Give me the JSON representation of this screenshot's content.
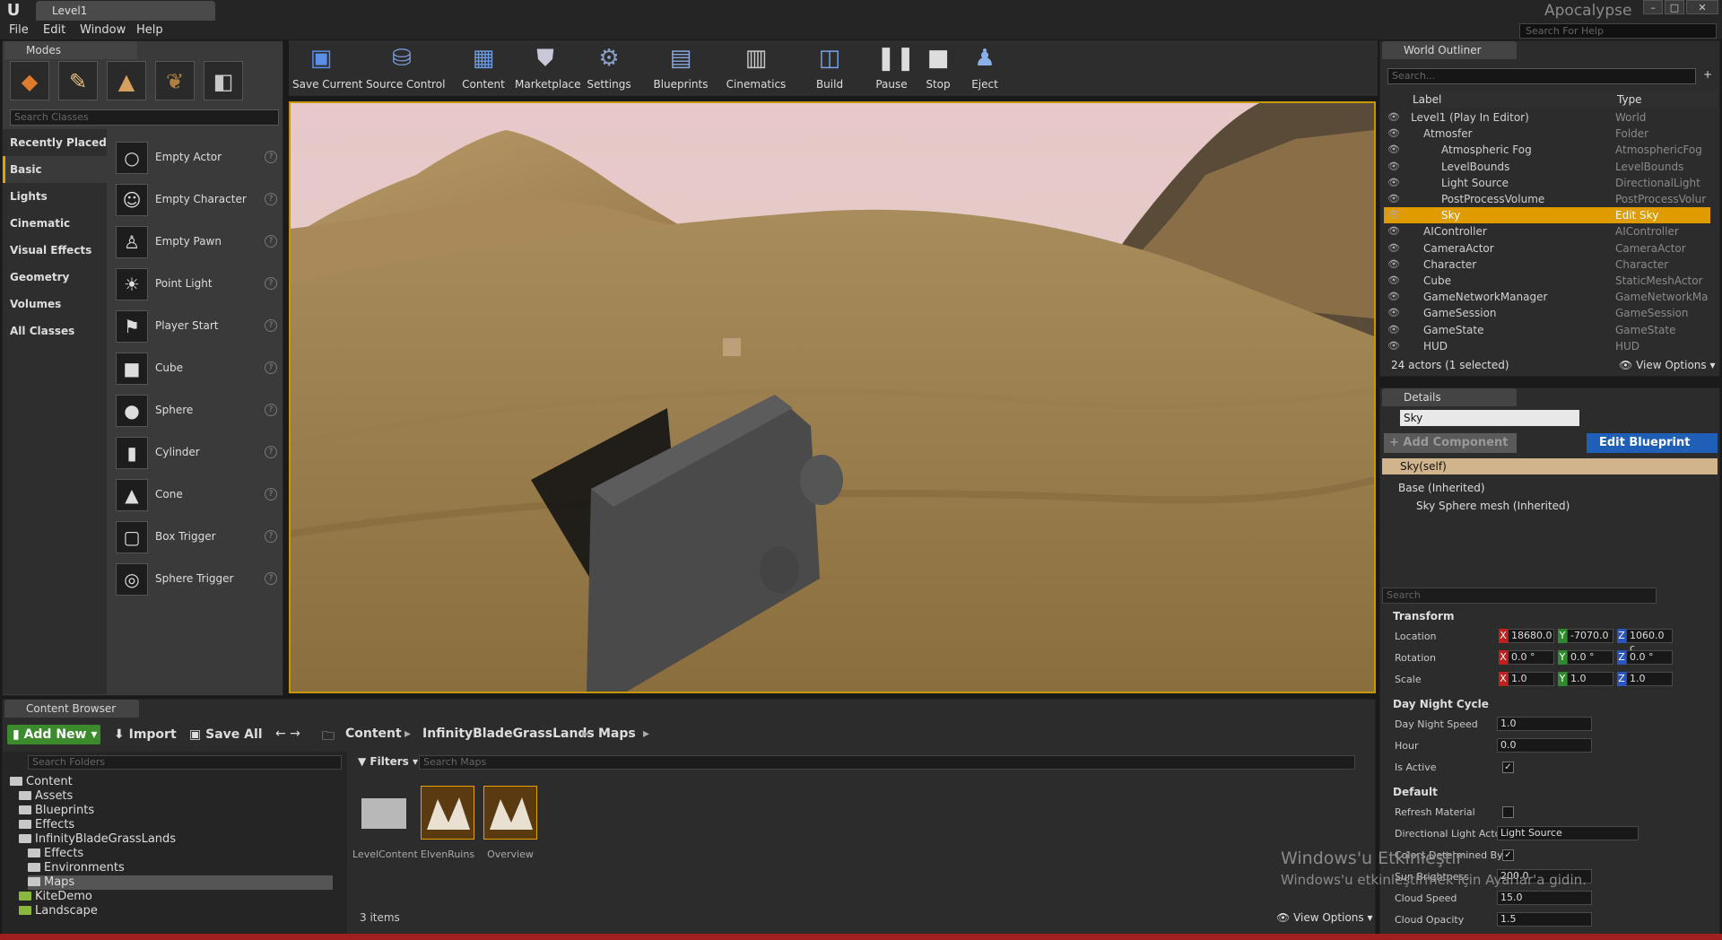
{
  "window": {
    "tab_title": "Level1",
    "project_name": "Apocalypse",
    "help_search_placeholder": "Search For Help"
  },
  "menu": [
    "File",
    "Edit",
    "Window",
    "Help"
  ],
  "modes": {
    "tab_label": "Modes",
    "search_placeholder": "Search Classes",
    "categories": [
      "Recently Placed",
      "Basic",
      "Lights",
      "Cinematic",
      "Visual Effects",
      "Geometry",
      "Volumes",
      "All Classes"
    ],
    "active_category": "Basic",
    "items": [
      "Empty Actor",
      "Empty Character",
      "Empty Pawn",
      "Point Light",
      "Player Start",
      "Cube",
      "Sphere",
      "Cylinder",
      "Cone",
      "Box Trigger",
      "Sphere Trigger"
    ]
  },
  "toolbar": {
    "save_current": "Save Current",
    "source_control": "Source Control",
    "content": "Content",
    "marketplace": "Marketplace",
    "settings": "Settings",
    "blueprints": "Blueprints",
    "cinematics": "Cinematics",
    "build": "Build",
    "pause": "Pause",
    "stop": "Stop",
    "eject": "Eject"
  },
  "outliner": {
    "tab_label": "World Outliner",
    "search_placeholder": "Search...",
    "col_label": "Label",
    "col_type": "Type",
    "rows": [
      {
        "label": "Level1 (Play In Editor)",
        "type": "World"
      },
      {
        "label": "Atmosfer",
        "type": "Folder"
      },
      {
        "label": "Atmospheric Fog",
        "type": "AtmosphericFog"
      },
      {
        "label": "LevelBounds",
        "type": "LevelBounds"
      },
      {
        "label": "Light Source",
        "type": "DirectionalLight"
      },
      {
        "label": "PostProcessVolume",
        "type": "PostProcessVolur"
      },
      {
        "label": "Sky",
        "type": "Edit Sky"
      },
      {
        "label": "AIController",
        "type": "AIController"
      },
      {
        "label": "CameraActor",
        "type": "CameraActor"
      },
      {
        "label": "Character",
        "type": "Character"
      },
      {
        "label": "Cube",
        "type": "StaticMeshActor"
      },
      {
        "label": "GameNetworkManager",
        "type": "GameNetworkMar"
      },
      {
        "label": "GameSession",
        "type": "GameSession"
      },
      {
        "label": "GameState",
        "type": "GameState"
      },
      {
        "label": "HUD",
        "type": "HUD"
      }
    ],
    "status": "24 actors (1 selected)",
    "view_options": "View Options"
  },
  "details": {
    "tab_label": "Details",
    "name_value": "Sky",
    "add_component": "+ Add Component",
    "edit_blueprint": "Edit Blueprint",
    "self_label": "Sky(self)",
    "base_inherited": "Base (Inherited)",
    "sky_sphere_mesh": "Sky Sphere mesh (Inherited)",
    "search_placeholder": "Search",
    "transform": {
      "section": "Transform",
      "location_label": "Location",
      "rotation_label": "Rotation",
      "scale_label": "Scale",
      "location": [
        "18680.0",
        "-7070.0",
        "1060.0 c"
      ],
      "rotation": [
        "0.0 °",
        "0.0 °",
        "0.0 °"
      ],
      "scale": [
        "1.0",
        "1.0",
        "1.0"
      ]
    },
    "day_night": {
      "section": "Day Night Cycle",
      "speed_label": "Day Night Speed",
      "speed": "1.0",
      "hour_label": "Hour",
      "hour": "0.0",
      "active_label": "Is Active"
    },
    "default": {
      "section": "Default",
      "refresh_label": "Refresh Material",
      "dir_light_label": "Directional Light Acto",
      "dir_light_value": "Light Source",
      "colors_label": "Colors Determined By",
      "sun_label": "Sun Brightness",
      "sun_value": "200.0",
      "cloud_speed_label": "Cloud Speed",
      "cloud_speed": "15.0",
      "cloud_opacity_label": "Cloud Opacity",
      "cloud_opacity": "1.5"
    }
  },
  "content_browser": {
    "tab_label": "Content Browser",
    "add_new": "Add New",
    "import": "Import",
    "save_all": "Save All",
    "breadcrumb": [
      "Content",
      "InfinityBladeGrassLands",
      "Maps"
    ],
    "search_folders": "Search Folders",
    "filters": "Filters",
    "search_maps": "Search Maps",
    "tree": [
      {
        "label": "Content",
        "indent": 0
      },
      {
        "label": "Assets",
        "indent": 1
      },
      {
        "label": "Blueprints",
        "indent": 1
      },
      {
        "label": "Effects",
        "indent": 1
      },
      {
        "label": "InfinityBladeGrassLands",
        "indent": 1
      },
      {
        "label": "Effects",
        "indent": 2
      },
      {
        "label": "Environments",
        "indent": 2
      },
      {
        "label": "Maps",
        "indent": 2
      },
      {
        "label": "KiteDemo",
        "indent": 1
      },
      {
        "label": "Landscape",
        "indent": 1
      }
    ],
    "assets": [
      "LevelContent",
      "ElvenRuins",
      "Overview"
    ],
    "item_count": "3 items",
    "view_options": "View Options"
  },
  "watermark": {
    "line1": "Windows'u Etkinleştir",
    "line2": "Windows'u etkinleştirmek için Ayarlar'a gidin."
  }
}
